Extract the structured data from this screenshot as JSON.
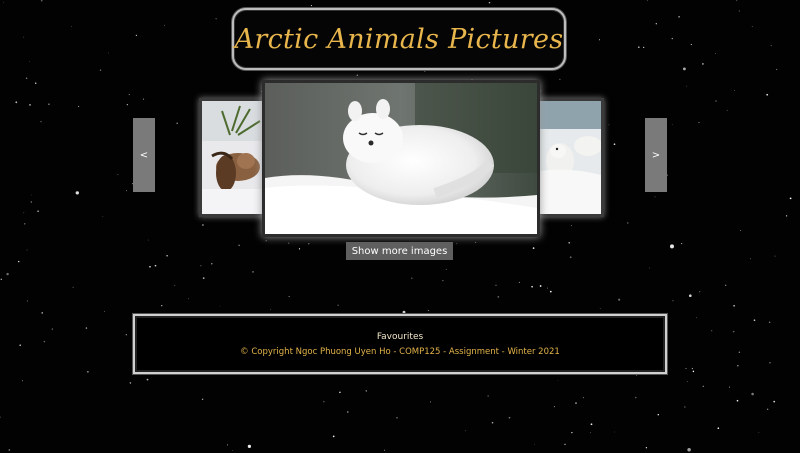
{
  "header": {
    "title": "Arctic Animals Pictures"
  },
  "carousel": {
    "prev_label": "<",
    "next_label": ">",
    "more_button_label": "Show more images"
  },
  "footer": {
    "favourites_label": "Favourites",
    "copyright": "© Copyright Ngoc Phuong Uyen Ho - COMP125 - Assignment - Winter 2021"
  },
  "colors": {
    "title_gold": "#e8b64c",
    "copyright_gold": "#e3b34a",
    "background": "#000000",
    "button_gray": "#5f5f5f"
  }
}
